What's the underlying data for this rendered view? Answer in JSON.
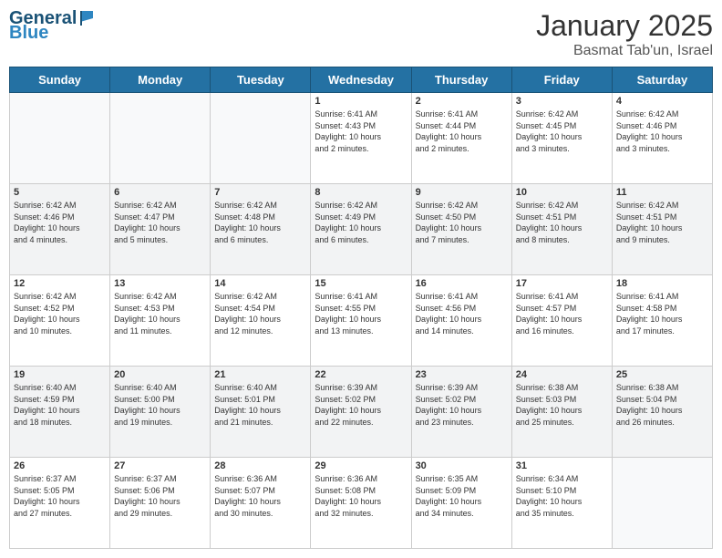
{
  "logo": {
    "line1": "General",
    "line2": "Blue"
  },
  "title": "January 2025",
  "location": "Basmat Tab'un, Israel",
  "days_of_week": [
    "Sunday",
    "Monday",
    "Tuesday",
    "Wednesday",
    "Thursday",
    "Friday",
    "Saturday"
  ],
  "weeks": [
    [
      {
        "num": "",
        "text": ""
      },
      {
        "num": "",
        "text": ""
      },
      {
        "num": "",
        "text": ""
      },
      {
        "num": "1",
        "text": "Sunrise: 6:41 AM\nSunset: 4:43 PM\nDaylight: 10 hours\nand 2 minutes."
      },
      {
        "num": "2",
        "text": "Sunrise: 6:41 AM\nSunset: 4:44 PM\nDaylight: 10 hours\nand 2 minutes."
      },
      {
        "num": "3",
        "text": "Sunrise: 6:42 AM\nSunset: 4:45 PM\nDaylight: 10 hours\nand 3 minutes."
      },
      {
        "num": "4",
        "text": "Sunrise: 6:42 AM\nSunset: 4:46 PM\nDaylight: 10 hours\nand 3 minutes."
      }
    ],
    [
      {
        "num": "5",
        "text": "Sunrise: 6:42 AM\nSunset: 4:46 PM\nDaylight: 10 hours\nand 4 minutes."
      },
      {
        "num": "6",
        "text": "Sunrise: 6:42 AM\nSunset: 4:47 PM\nDaylight: 10 hours\nand 5 minutes."
      },
      {
        "num": "7",
        "text": "Sunrise: 6:42 AM\nSunset: 4:48 PM\nDaylight: 10 hours\nand 6 minutes."
      },
      {
        "num": "8",
        "text": "Sunrise: 6:42 AM\nSunset: 4:49 PM\nDaylight: 10 hours\nand 6 minutes."
      },
      {
        "num": "9",
        "text": "Sunrise: 6:42 AM\nSunset: 4:50 PM\nDaylight: 10 hours\nand 7 minutes."
      },
      {
        "num": "10",
        "text": "Sunrise: 6:42 AM\nSunset: 4:51 PM\nDaylight: 10 hours\nand 8 minutes."
      },
      {
        "num": "11",
        "text": "Sunrise: 6:42 AM\nSunset: 4:51 PM\nDaylight: 10 hours\nand 9 minutes."
      }
    ],
    [
      {
        "num": "12",
        "text": "Sunrise: 6:42 AM\nSunset: 4:52 PM\nDaylight: 10 hours\nand 10 minutes."
      },
      {
        "num": "13",
        "text": "Sunrise: 6:42 AM\nSunset: 4:53 PM\nDaylight: 10 hours\nand 11 minutes."
      },
      {
        "num": "14",
        "text": "Sunrise: 6:42 AM\nSunset: 4:54 PM\nDaylight: 10 hours\nand 12 minutes."
      },
      {
        "num": "15",
        "text": "Sunrise: 6:41 AM\nSunset: 4:55 PM\nDaylight: 10 hours\nand 13 minutes."
      },
      {
        "num": "16",
        "text": "Sunrise: 6:41 AM\nSunset: 4:56 PM\nDaylight: 10 hours\nand 14 minutes."
      },
      {
        "num": "17",
        "text": "Sunrise: 6:41 AM\nSunset: 4:57 PM\nDaylight: 10 hours\nand 16 minutes."
      },
      {
        "num": "18",
        "text": "Sunrise: 6:41 AM\nSunset: 4:58 PM\nDaylight: 10 hours\nand 17 minutes."
      }
    ],
    [
      {
        "num": "19",
        "text": "Sunrise: 6:40 AM\nSunset: 4:59 PM\nDaylight: 10 hours\nand 18 minutes."
      },
      {
        "num": "20",
        "text": "Sunrise: 6:40 AM\nSunset: 5:00 PM\nDaylight: 10 hours\nand 19 minutes."
      },
      {
        "num": "21",
        "text": "Sunrise: 6:40 AM\nSunset: 5:01 PM\nDaylight: 10 hours\nand 21 minutes."
      },
      {
        "num": "22",
        "text": "Sunrise: 6:39 AM\nSunset: 5:02 PM\nDaylight: 10 hours\nand 22 minutes."
      },
      {
        "num": "23",
        "text": "Sunrise: 6:39 AM\nSunset: 5:02 PM\nDaylight: 10 hours\nand 23 minutes."
      },
      {
        "num": "24",
        "text": "Sunrise: 6:38 AM\nSunset: 5:03 PM\nDaylight: 10 hours\nand 25 minutes."
      },
      {
        "num": "25",
        "text": "Sunrise: 6:38 AM\nSunset: 5:04 PM\nDaylight: 10 hours\nand 26 minutes."
      }
    ],
    [
      {
        "num": "26",
        "text": "Sunrise: 6:37 AM\nSunset: 5:05 PM\nDaylight: 10 hours\nand 27 minutes."
      },
      {
        "num": "27",
        "text": "Sunrise: 6:37 AM\nSunset: 5:06 PM\nDaylight: 10 hours\nand 29 minutes."
      },
      {
        "num": "28",
        "text": "Sunrise: 6:36 AM\nSunset: 5:07 PM\nDaylight: 10 hours\nand 30 minutes."
      },
      {
        "num": "29",
        "text": "Sunrise: 6:36 AM\nSunset: 5:08 PM\nDaylight: 10 hours\nand 32 minutes."
      },
      {
        "num": "30",
        "text": "Sunrise: 6:35 AM\nSunset: 5:09 PM\nDaylight: 10 hours\nand 34 minutes."
      },
      {
        "num": "31",
        "text": "Sunrise: 6:34 AM\nSunset: 5:10 PM\nDaylight: 10 hours\nand 35 minutes."
      },
      {
        "num": "",
        "text": ""
      }
    ]
  ]
}
